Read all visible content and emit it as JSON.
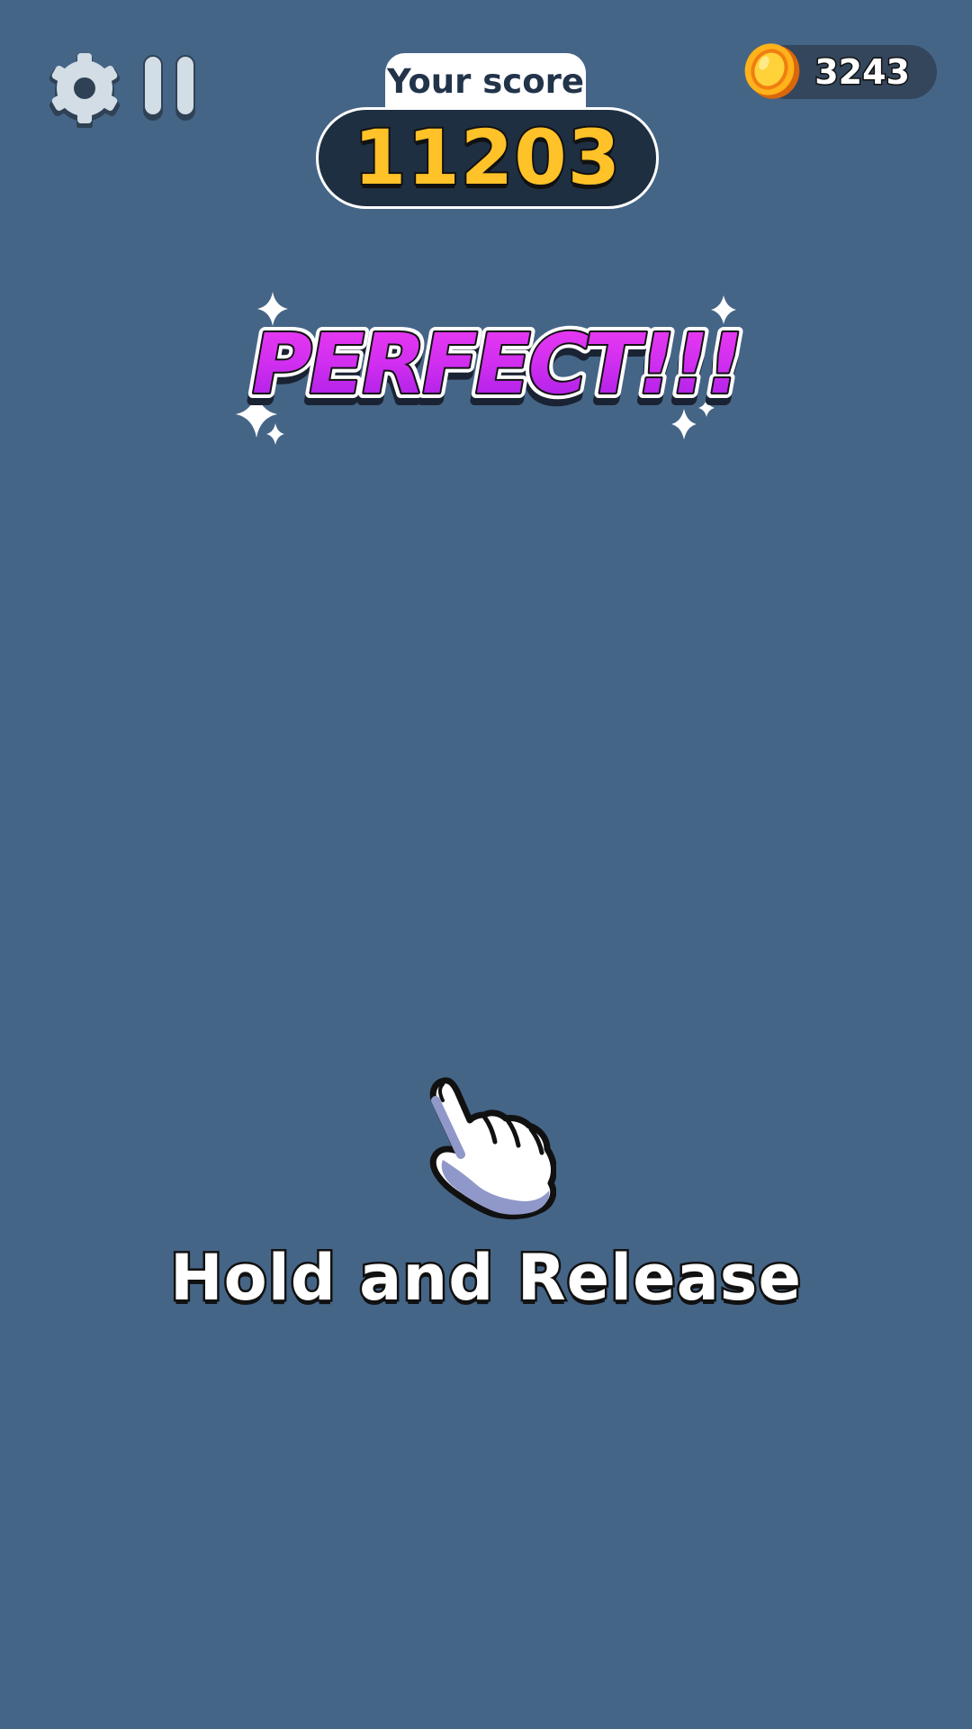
{
  "hud": {
    "score_label": "Your score",
    "score_value": "11203",
    "coins": "3243",
    "settings_icon": "gear-icon",
    "pause_icon": "pause-icon",
    "coin_icon": "coin-icon"
  },
  "feedback": {
    "text": "PERFECT!!!"
  },
  "tutorial": {
    "hand_icon": "pointing-hand-icon",
    "instruction": "Hold and Release"
  },
  "colors": {
    "background": "#456587",
    "score_box": "#1f2f42",
    "score_text": "#ffc228",
    "perfect_top": "#ee3cf2",
    "perfect_bottom": "#a41de4",
    "coin": "#ffc21a"
  }
}
